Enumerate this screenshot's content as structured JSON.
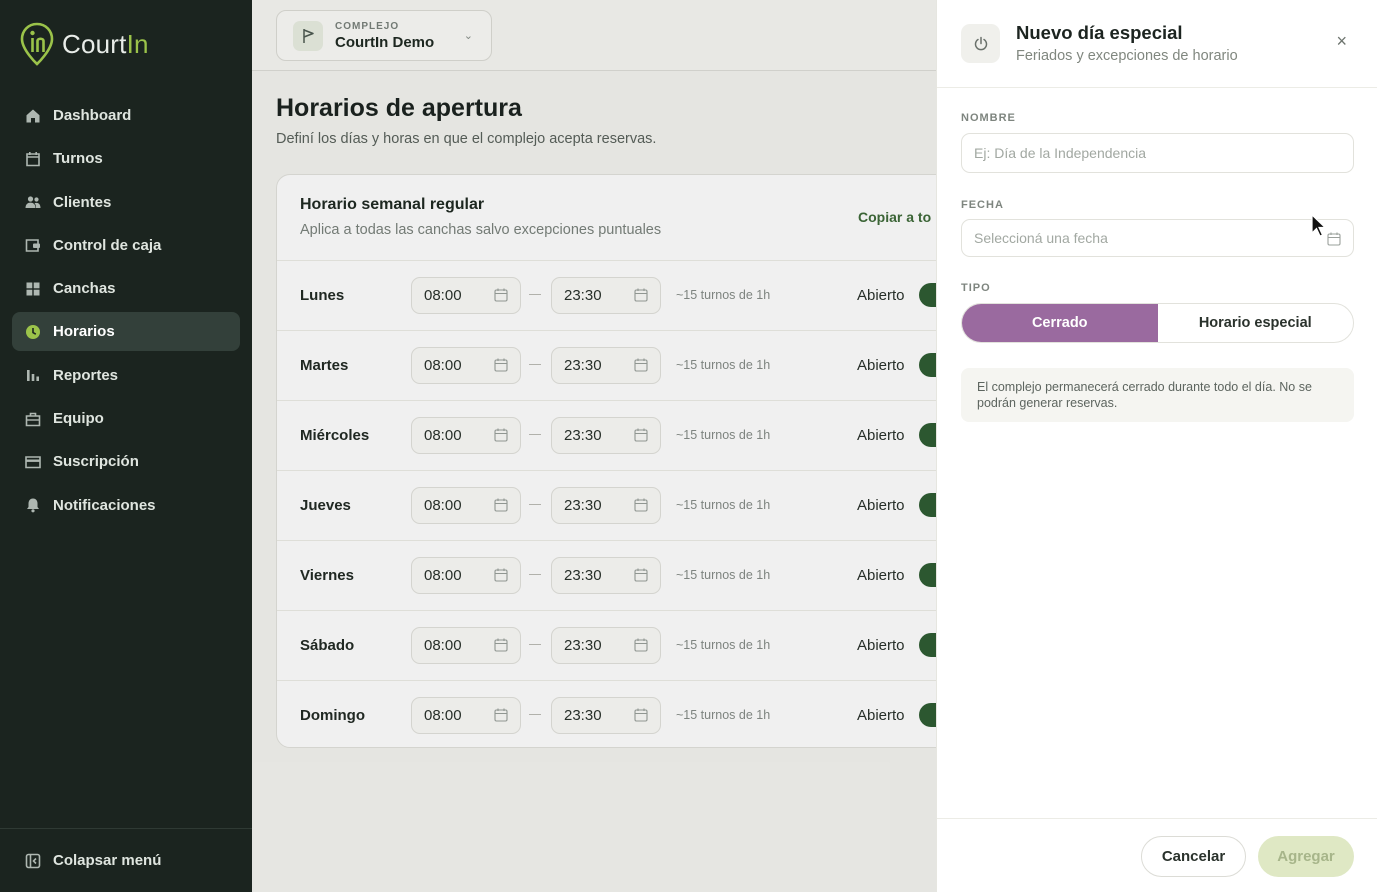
{
  "brand": {
    "name_prefix": "Court",
    "name_suffix": "In",
    "accent": "#9bc34a"
  },
  "sidebar": {
    "items": [
      {
        "label": "Dashboard",
        "icon": "home-icon",
        "active": false
      },
      {
        "label": "Turnos",
        "icon": "calendar-icon",
        "active": false
      },
      {
        "label": "Clientes",
        "icon": "users-icon",
        "active": false
      },
      {
        "label": "Control de caja",
        "icon": "wallet-icon",
        "active": false
      },
      {
        "label": "Canchas",
        "icon": "grid-icon",
        "active": false
      },
      {
        "label": "Horarios",
        "icon": "clock-icon",
        "active": true
      },
      {
        "label": "Reportes",
        "icon": "bar-chart-icon",
        "active": false
      },
      {
        "label": "Equipo",
        "icon": "briefcase-icon",
        "active": false
      },
      {
        "label": "Suscripción",
        "icon": "credit-card-icon",
        "active": false
      },
      {
        "label": "Notificaciones",
        "icon": "bell-icon",
        "active": false
      }
    ],
    "collapse_label": "Colapsar menú"
  },
  "topbar": {
    "complex_label": "COMPLEJO",
    "complex_value": "CourtIn Demo"
  },
  "page": {
    "title": "Horarios de apertura",
    "subtitle": "Definí los días y horas en que el complejo acepta reservas."
  },
  "schedule": {
    "title": "Horario semanal regular",
    "subtitle": "Aplica a todas las canchas salvo excepciones puntuales",
    "copy_label": "Copiar a to",
    "days": [
      {
        "name": "Lunes",
        "open": "08:00",
        "close": "23:30",
        "slots": "~15 turnos de 1h",
        "status": "Abierto"
      },
      {
        "name": "Martes",
        "open": "08:00",
        "close": "23:30",
        "slots": "~15 turnos de 1h",
        "status": "Abierto"
      },
      {
        "name": "Miércoles",
        "open": "08:00",
        "close": "23:30",
        "slots": "~15 turnos de 1h",
        "status": "Abierto"
      },
      {
        "name": "Jueves",
        "open": "08:00",
        "close": "23:30",
        "slots": "~15 turnos de 1h",
        "status": "Abierto"
      },
      {
        "name": "Viernes",
        "open": "08:00",
        "close": "23:30",
        "slots": "~15 turnos de 1h",
        "status": "Abierto"
      },
      {
        "name": "Sábado",
        "open": "08:00",
        "close": "23:30",
        "slots": "~15 turnos de 1h",
        "status": "Abierto"
      },
      {
        "name": "Domingo",
        "open": "08:00",
        "close": "23:30",
        "slots": "~15 turnos de 1h",
        "status": "Abierto"
      }
    ]
  },
  "panel": {
    "title": "Nuevo día especial",
    "subtitle": "Feriados y excepciones de horario",
    "close": "×",
    "name_label": "NOMBRE",
    "name_placeholder": "Ej: Día de la Independencia",
    "date_label": "FECHA",
    "date_placeholder": "Seleccioná una fecha",
    "type_label": "TIPO",
    "type_options": [
      "Cerrado",
      "Horario especial"
    ],
    "type_selected": "Cerrado",
    "note": "El complejo permanecerá cerrado durante todo el día. No se podrán generar reservas.",
    "cancel_label": "Cancelar",
    "add_label": "Agregar"
  },
  "colors": {
    "toggle_on": "#2f5d34",
    "segment_active": "#9a6a9f",
    "sidebar_bg": "#1b241f"
  }
}
